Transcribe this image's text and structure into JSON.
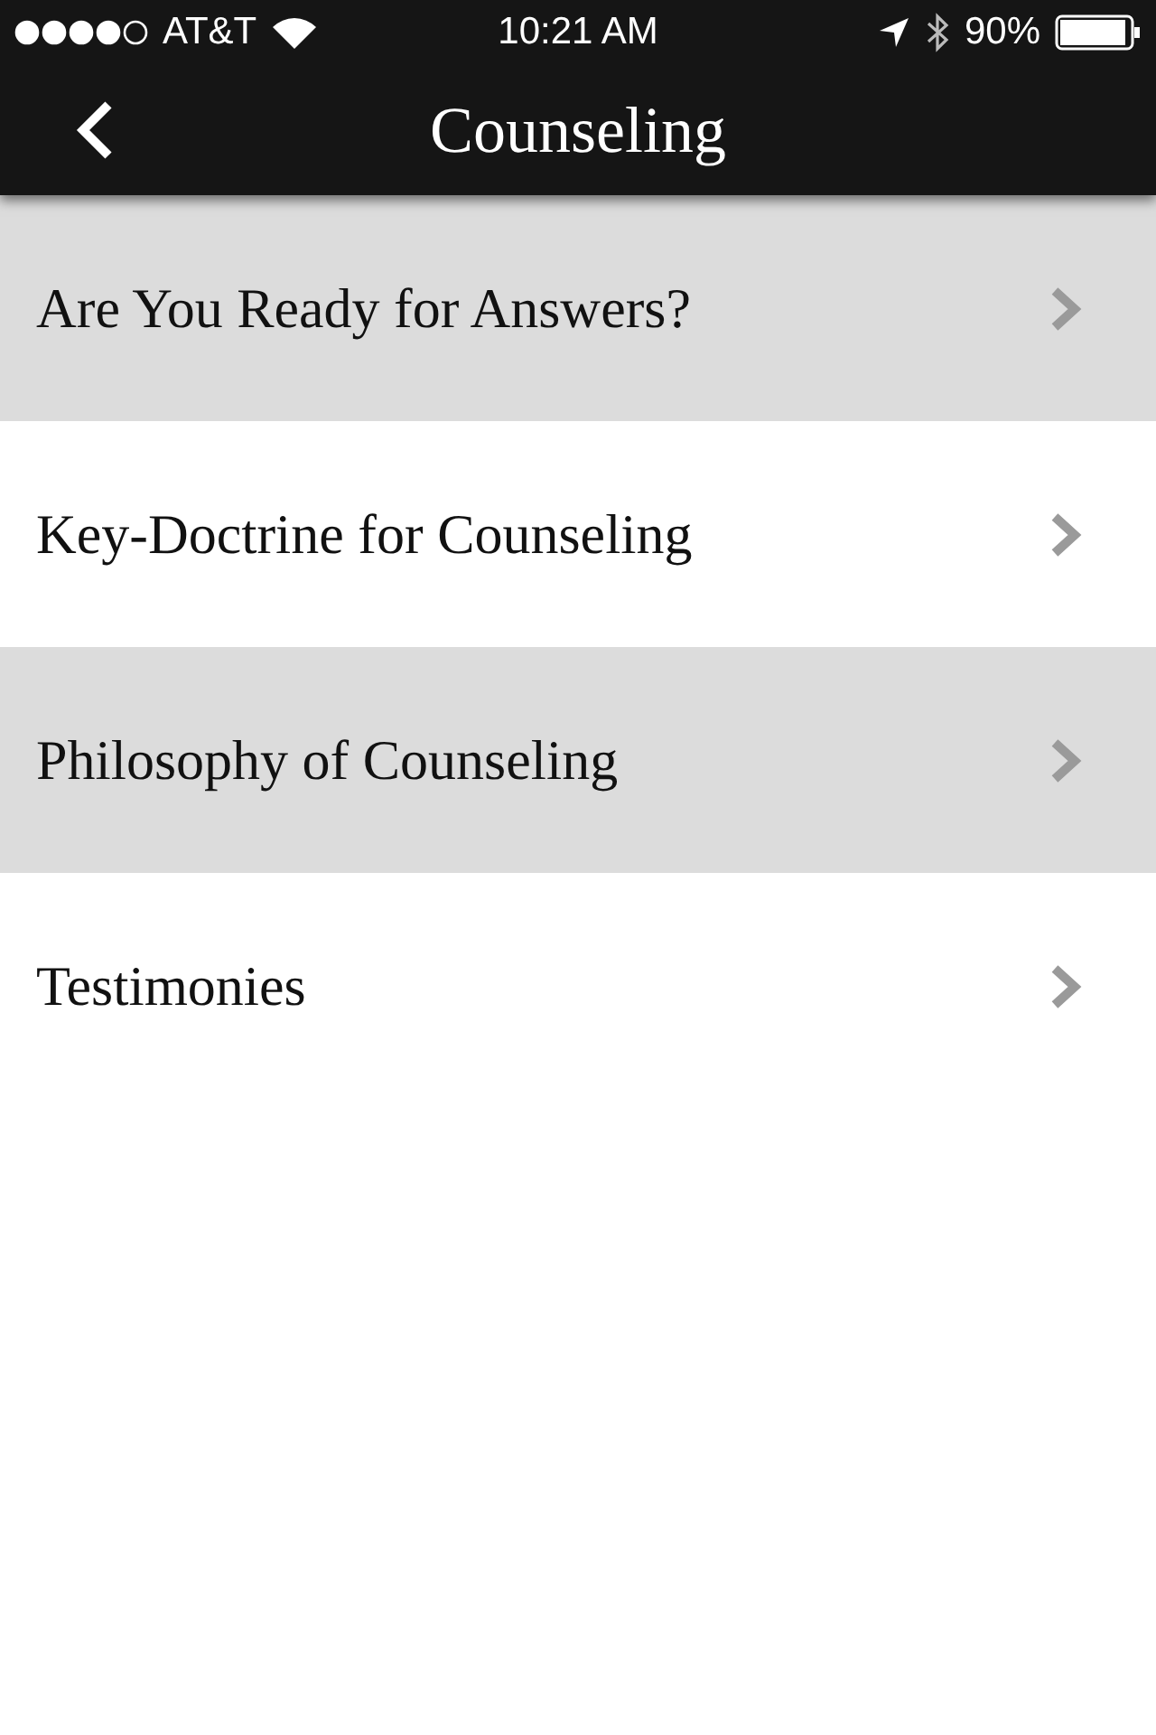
{
  "status_bar": {
    "carrier": "AT&T",
    "time": "10:21 AM",
    "battery": "90%"
  },
  "nav_bar": {
    "title": "Counseling"
  },
  "menu": [
    {
      "label": "Are You Ready for Answers?"
    },
    {
      "label": "Key-Doctrine for Counseling"
    },
    {
      "label": "Philosophy of Counseling"
    },
    {
      "label": "Testimonies"
    }
  ]
}
